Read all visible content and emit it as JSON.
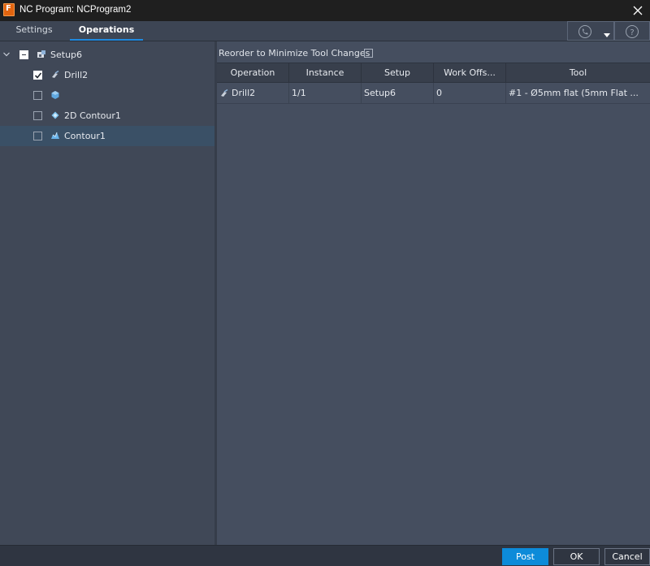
{
  "window": {
    "title": "NC Program: NCProgram2"
  },
  "tabs": [
    {
      "label": "Settings",
      "active": false
    },
    {
      "label": "Operations",
      "active": true
    }
  ],
  "toolbar_icons": [
    "phone-icon",
    "dropdown-caret-icon",
    "help-icon"
  ],
  "tree": {
    "setup": {
      "label": "Setup6",
      "state": "partial",
      "icon": "setup-icon"
    },
    "items": [
      {
        "label": "Drill2",
        "checked": true,
        "icon": "drill-icon"
      },
      {
        "label": "",
        "checked": false,
        "icon": "shape-icon"
      },
      {
        "label": "2D Contour1",
        "checked": false,
        "icon": "contour-2d-icon"
      },
      {
        "label": "Contour1",
        "checked": false,
        "icon": "contour-3d-icon",
        "selected": true
      }
    ]
  },
  "reorder": {
    "label": "Reorder to Minimize Tool Changes",
    "checked": false
  },
  "grid": {
    "columns": [
      "Operation",
      "Instance",
      "Setup",
      "Work Offs...",
      "Tool"
    ],
    "rows": [
      {
        "operation": "Drill2",
        "instance": "1/1",
        "setup": "Setup6",
        "work_offset": "0",
        "tool": "#1 - Ø5mm flat (5mm Flat ..."
      }
    ]
  },
  "footer": {
    "post_label": "Post",
    "ok_label": "OK",
    "cancel_label": "Cancel"
  },
  "colors": {
    "accent": "#0d8bd9",
    "brand": "#e2640f",
    "selection": "#3a5066"
  }
}
